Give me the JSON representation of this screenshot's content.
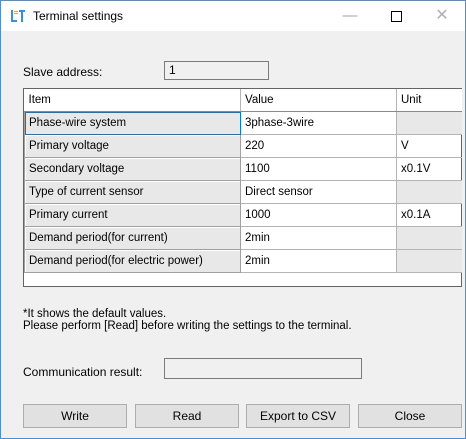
{
  "window": {
    "title": "Terminal settings",
    "controls": {
      "minimize": "—",
      "close": "✕"
    }
  },
  "slave_address": {
    "label": "Slave address:",
    "value": "1"
  },
  "table": {
    "headers": [
      "Item",
      "Value",
      "Unit"
    ],
    "rows": [
      {
        "item": "Phase-wire system",
        "value": "3phase-3wire",
        "unit": ""
      },
      {
        "item": "Primary voltage",
        "value": "220",
        "unit": "V"
      },
      {
        "item": "Secondary voltage",
        "value": "1100",
        "unit": "x0.1V"
      },
      {
        "item": "Type of current sensor",
        "value": "Direct sensor",
        "unit": ""
      },
      {
        "item": "Primary current",
        "value": "1000",
        "unit": "x0.1A"
      },
      {
        "item": "Demand period(for current)",
        "value": "2min",
        "unit": ""
      },
      {
        "item": "Demand period(for electric power)",
        "value": "2min",
        "unit": ""
      }
    ]
  },
  "notes": {
    "line1": "*It shows the default values.",
    "line2": "Please perform [Read] before writing the settings to the terminal."
  },
  "communication": {
    "label": "Communication result:",
    "value": ""
  },
  "buttons": {
    "write": "Write",
    "read": "Read",
    "export": "Export to CSV",
    "close": "Close"
  },
  "colors": {
    "border_accent": "#4a8fd8",
    "selection": "#0078d7"
  }
}
